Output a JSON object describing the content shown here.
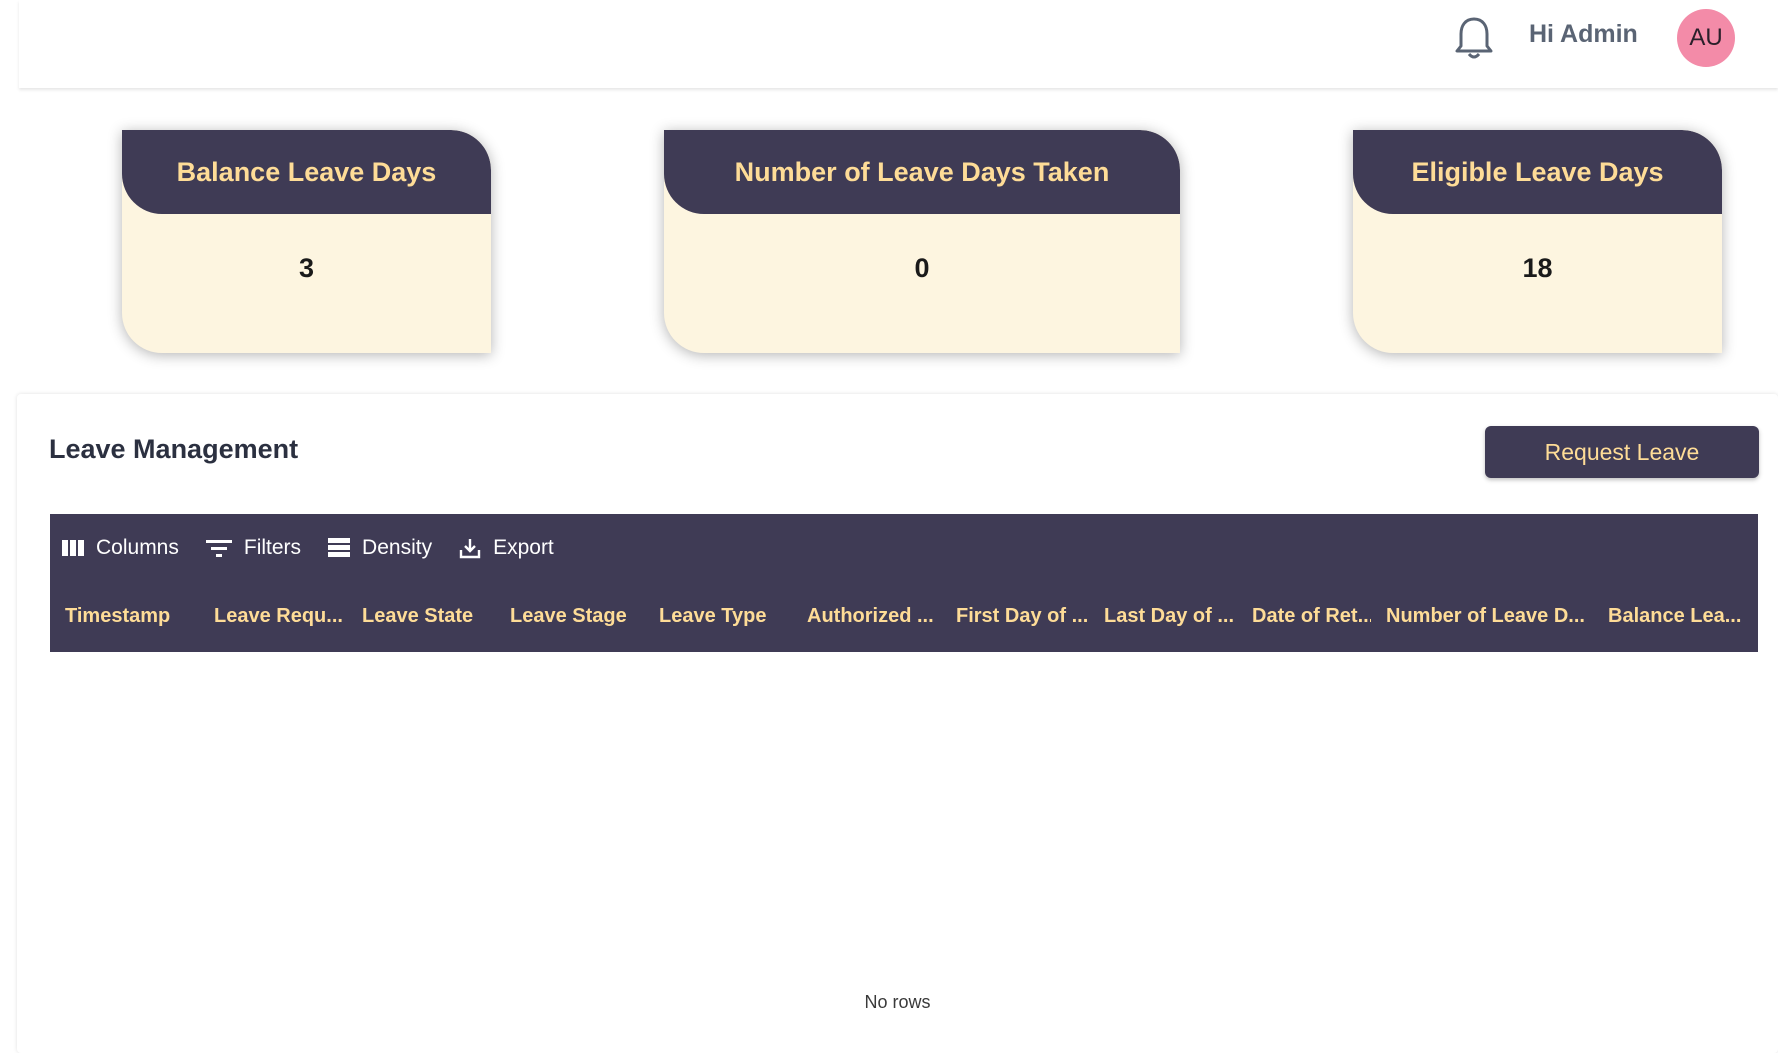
{
  "header": {
    "greeting": "Hi Admin",
    "avatar_initials": "AU",
    "notification_icon": "bell-icon"
  },
  "stats": [
    {
      "label": "Balance Leave Days",
      "value": "3"
    },
    {
      "label": "Number of Leave Days Taken",
      "value": "0"
    },
    {
      "label": "Eligible Leave Days",
      "value": "18"
    }
  ],
  "leave_management": {
    "title": "Leave Management",
    "request_button": "Request Leave",
    "toolbar": {
      "columns": "Columns",
      "filters": "Filters",
      "density": "Density",
      "export": "Export"
    },
    "columns": [
      "Timestamp",
      "Leave Requ...",
      "Leave State",
      "Leave Stage",
      "Leave Type",
      "Authorized ...",
      "First Day of ...",
      "Last Day of ...",
      "Date of Ret...",
      "Number of Leave D...",
      "Balance Lea..."
    ],
    "empty_text": "No rows"
  },
  "colors": {
    "primary": "#3f3b55",
    "accent": "#fedc97",
    "card_body": "#fdf5e0",
    "avatar": "#f38ba8"
  }
}
